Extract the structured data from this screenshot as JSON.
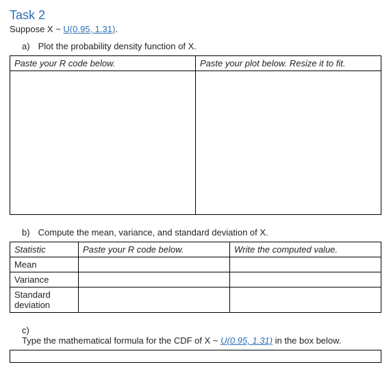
{
  "title": "Task 2",
  "suppose_prefix": "Suppose X ~ ",
  "suppose_dist": "U(0.95, 1.31)",
  "suppose_suffix": ".",
  "a": {
    "label": "a)",
    "text": "Plot the probability density function of X.",
    "left_header": "Paste your R code below.",
    "right_header": "Paste your plot below. Resize it to fit."
  },
  "b": {
    "label": "b)",
    "text": "Compute the mean, variance, and standard deviation of X.",
    "col1": "Statistic",
    "col2": "Paste your R code below.",
    "col3": "Write the computed value.",
    "rows": [
      "Mean",
      "Variance",
      "Standard deviation"
    ]
  },
  "c": {
    "label": "c)",
    "text_prefix": "Type the mathematical formula for the CDF of X ~ ",
    "text_dist": "U(0.95, 1.31)",
    "text_suffix": " in the box below."
  }
}
